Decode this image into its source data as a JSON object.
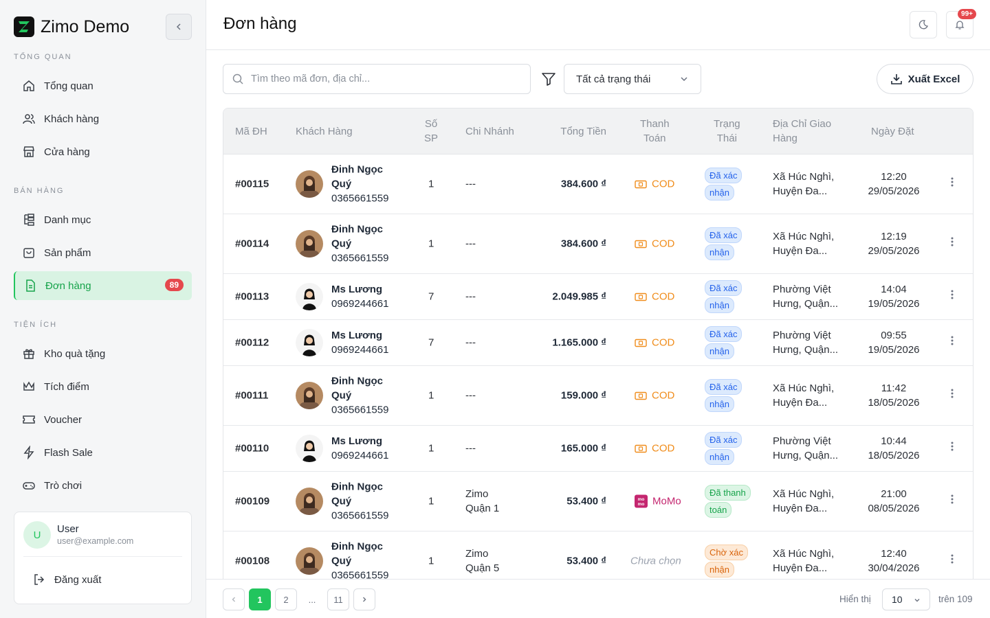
{
  "brand": {
    "name": "Zimo Demo"
  },
  "sidebar": {
    "sections": [
      {
        "label": "TỔNG QUAN",
        "items": [
          {
            "label": "Tổng quan",
            "icon": "home-icon"
          },
          {
            "label": "Khách hàng",
            "icon": "users-icon"
          },
          {
            "label": "Cửa hàng",
            "icon": "store-icon"
          }
        ]
      },
      {
        "label": "BÁN HÀNG",
        "items": [
          {
            "label": "Danh mục",
            "icon": "category-tree-icon"
          },
          {
            "label": "Sản phẩm",
            "icon": "shopping-bag-icon"
          },
          {
            "label": "Đơn hàng",
            "icon": "document-icon",
            "badge": "89",
            "active": true
          }
        ]
      },
      {
        "label": "TIỆN ÍCH",
        "items": [
          {
            "label": "Kho quà tặng",
            "icon": "gift-icon"
          },
          {
            "label": "Tích điểm",
            "icon": "crown-icon"
          },
          {
            "label": "Voucher",
            "icon": "ticket-icon"
          },
          {
            "label": "Flash Sale",
            "icon": "lightning-icon"
          },
          {
            "label": "Trò chơi",
            "icon": "gamepad-icon"
          }
        ]
      }
    ],
    "user": {
      "initial": "U",
      "name": "User",
      "email": "user@example.com",
      "logout_label": "Đăng xuất"
    }
  },
  "header": {
    "title": "Đơn hàng",
    "notification_badge": "99+"
  },
  "toolbar": {
    "search_placeholder": "Tìm theo mã đơn, địa chỉ...",
    "status_filter": "Tất cả trạng thái",
    "export_label": "Xuất Excel"
  },
  "table": {
    "columns": {
      "id": "Mã ĐH",
      "customer": "Khách Hàng",
      "qty": [
        "Số",
        "SP"
      ],
      "branch": "Chi Nhánh",
      "total": "Tổng Tiền",
      "payment": [
        "Thanh",
        "Toán"
      ],
      "status": [
        "Trạng",
        "Thái"
      ],
      "address": [
        "Địa Chỉ Giao",
        "Hàng"
      ],
      "date": "Ngày Đặt"
    },
    "rows": [
      {
        "id": "#00115",
        "name": [
          "Đinh Ngọc",
          "Quý"
        ],
        "phone": "0365661559",
        "avatar": "a",
        "qty": "1",
        "branch": [
          "---"
        ],
        "total": "384.600 ₫",
        "payment": "COD",
        "payment_type": "cod",
        "status": [
          "Đã xác",
          "nhận"
        ],
        "status_color": "blue",
        "address": [
          "Xã Húc Nghì,",
          "Huyện Đa..."
        ],
        "time": "12:20",
        "date": "29/05/2026"
      },
      {
        "id": "#00114",
        "name": [
          "Đinh Ngọc",
          "Quý"
        ],
        "phone": "0365661559",
        "avatar": "a",
        "qty": "1",
        "branch": [
          "---"
        ],
        "total": "384.600 ₫",
        "payment": "COD",
        "payment_type": "cod",
        "status": [
          "Đã xác",
          "nhận"
        ],
        "status_color": "blue",
        "address": [
          "Xã Húc Nghì,",
          "Huyện Đa..."
        ],
        "time": "12:19",
        "date": "29/05/2026"
      },
      {
        "id": "#00113",
        "name": [
          "Ms Lương"
        ],
        "phone": "0969244661",
        "avatar": "b",
        "qty": "7",
        "branch": [
          "---"
        ],
        "total": "2.049.985 ₫",
        "payment": "COD",
        "payment_type": "cod",
        "status": [
          "Đã xác",
          "nhận"
        ],
        "status_color": "blue",
        "address": [
          "Phường Việt",
          "Hưng, Quận..."
        ],
        "time": "14:04",
        "date": "19/05/2026"
      },
      {
        "id": "#00112",
        "name": [
          "Ms Lương"
        ],
        "phone": "0969244661",
        "avatar": "b",
        "qty": "7",
        "branch": [
          "---"
        ],
        "total": "1.165.000 ₫",
        "payment": "COD",
        "payment_type": "cod",
        "status": [
          "Đã xác",
          "nhận"
        ],
        "status_color": "blue",
        "address": [
          "Phường Việt",
          "Hưng, Quận..."
        ],
        "time": "09:55",
        "date": "19/05/2026"
      },
      {
        "id": "#00111",
        "name": [
          "Đinh Ngọc",
          "Quý"
        ],
        "phone": "0365661559",
        "avatar": "a",
        "qty": "1",
        "branch": [
          "---"
        ],
        "total": "159.000 ₫",
        "payment": "COD",
        "payment_type": "cod",
        "status": [
          "Đã xác",
          "nhận"
        ],
        "status_color": "blue",
        "address": [
          "Xã Húc Nghì,",
          "Huyện Đa..."
        ],
        "time": "11:42",
        "date": "18/05/2026"
      },
      {
        "id": "#00110",
        "name": [
          "Ms Lương"
        ],
        "phone": "0969244661",
        "avatar": "b",
        "qty": "1",
        "branch": [
          "---"
        ],
        "total": "165.000 ₫",
        "payment": "COD",
        "payment_type": "cod",
        "status": [
          "Đã xác",
          "nhận"
        ],
        "status_color": "blue",
        "address": [
          "Phường Việt",
          "Hưng, Quận..."
        ],
        "time": "10:44",
        "date": "18/05/2026"
      },
      {
        "id": "#00109",
        "name": [
          "Đinh Ngọc",
          "Quý"
        ],
        "phone": "0365661559",
        "avatar": "a",
        "qty": "1",
        "branch": [
          "Zimo",
          "Quận 1"
        ],
        "total": "53.400 ₫",
        "payment": "MoMo",
        "payment_type": "momo",
        "status": [
          "Đã thanh",
          "toán"
        ],
        "status_color": "green",
        "address": [
          "Xã Húc Nghì,",
          "Huyện Đa..."
        ],
        "time": "21:00",
        "date": "08/05/2026"
      },
      {
        "id": "#00108",
        "name": [
          "Đinh Ngọc",
          "Quý"
        ],
        "phone": "0365661559",
        "avatar": "a",
        "qty": "1",
        "branch": [
          "Zimo",
          "Quận 5"
        ],
        "total": "53.400 ₫",
        "payment": "Chưa chọn",
        "payment_type": "none",
        "status": [
          "Chờ xác",
          "nhận"
        ],
        "status_color": "orange",
        "address": [
          "Xã Húc Nghì,",
          "Huyện Đa..."
        ],
        "time": "12:40",
        "date": "30/04/2026"
      }
    ]
  },
  "pagination": {
    "pages": [
      "1",
      "2",
      "...",
      "11"
    ],
    "current": "1",
    "show_label": "Hiển thị",
    "page_size": "10",
    "total_label": "trên 109"
  },
  "colors": {
    "accent": "#22c55e",
    "badge": "#e5484d",
    "cod": "#f08c1a",
    "momo": "#c4266f"
  }
}
